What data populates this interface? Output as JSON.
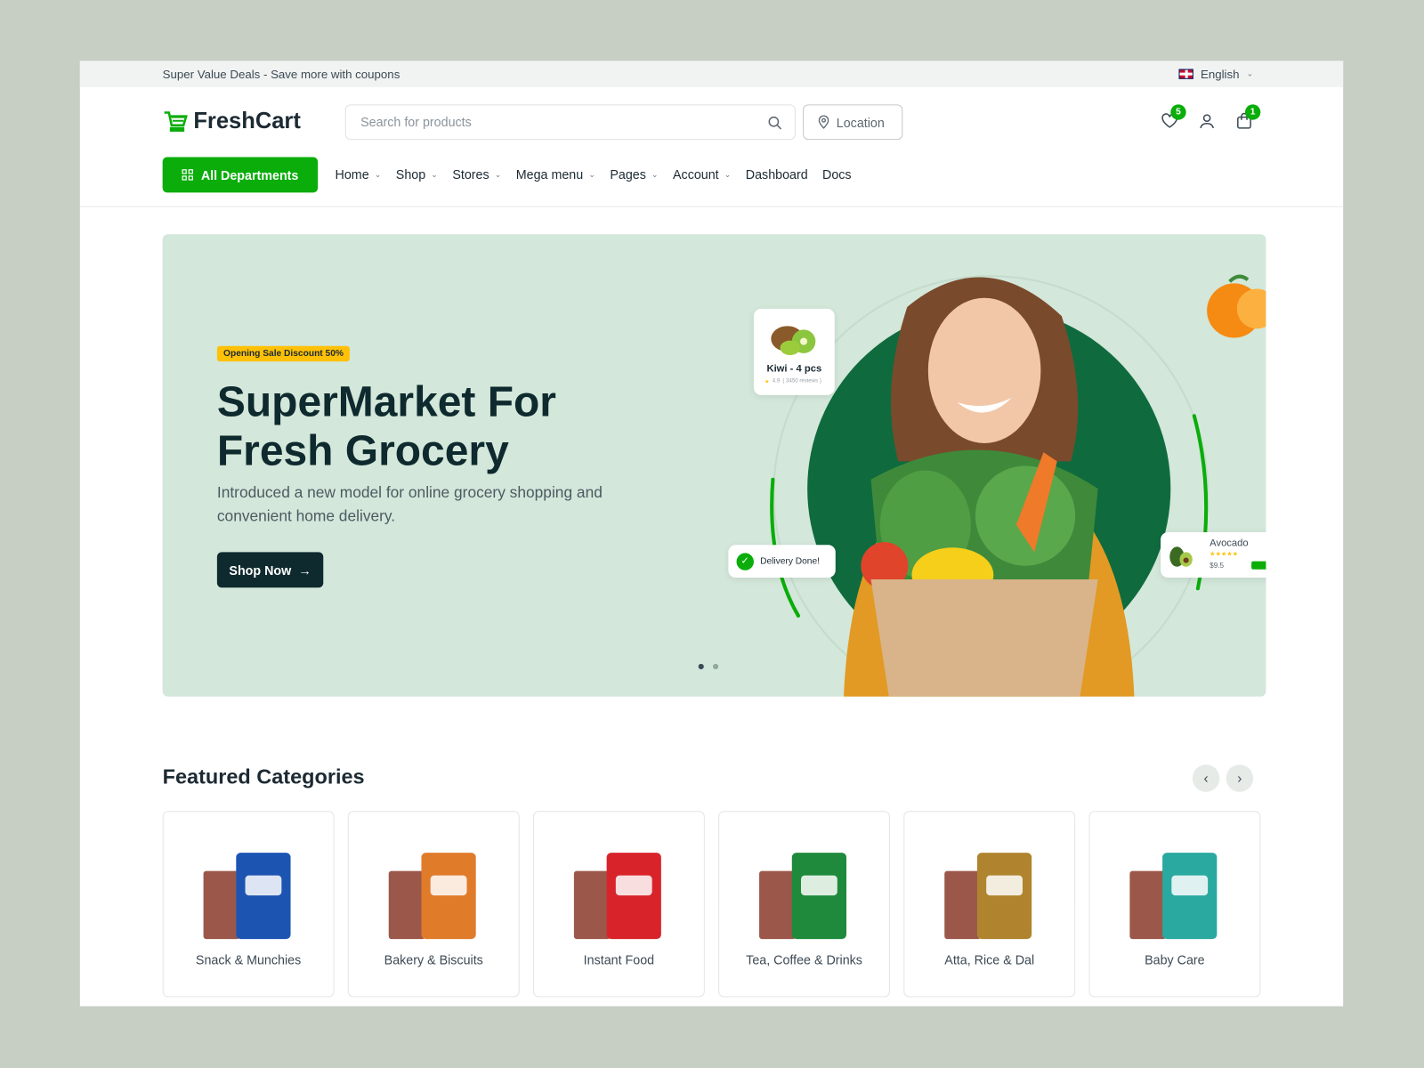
{
  "topbar": {
    "deal": "Super Value Deals - Save more with coupons",
    "language": "English"
  },
  "header": {
    "logo": "FreshCart",
    "search_placeholder": "Search for products",
    "location_label": "Location",
    "wishlist_count": "5",
    "cart_count": "1"
  },
  "nav": {
    "departments": "All Departments",
    "items": [
      {
        "label": "Home",
        "dropdown": true
      },
      {
        "label": "Shop",
        "dropdown": true
      },
      {
        "label": "Stores",
        "dropdown": true
      },
      {
        "label": "Mega menu",
        "dropdown": true
      },
      {
        "label": "Pages",
        "dropdown": true
      },
      {
        "label": "Account",
        "dropdown": true
      },
      {
        "label": "Dashboard",
        "dropdown": false
      },
      {
        "label": "Docs",
        "dropdown": false
      }
    ]
  },
  "hero": {
    "tag": "Opening Sale Discount 50%",
    "title": "SuperMarket For Fresh Grocery",
    "subtitle": "Introduced a new model for online grocery shopping and convenient home delivery.",
    "cta": "Shop Now",
    "kiwi": {
      "name": "Kiwi - 4 pcs",
      "rating": "4.9",
      "reviews": "( 3450 reviews )"
    },
    "delivery": "Delivery Done!",
    "avocado": {
      "name": "Avocado",
      "price": "$9.5"
    },
    "slides": 2,
    "active_slide": 1
  },
  "featured": {
    "title": "Featured Categories",
    "categories": [
      {
        "label": "Snack & Munchies",
        "color": "#1c54b2"
      },
      {
        "label": "Bakery & Biscuits",
        "color": "#e07b2a"
      },
      {
        "label": "Instant Food",
        "color": "#d8232a"
      },
      {
        "label": "Tea, Coffee & Drinks",
        "color": "#1f8a3b"
      },
      {
        "label": "Atta, Rice & Dal",
        "color": "#b0842f"
      },
      {
        "label": "Baby Care",
        "color": "#2aa9a0"
      }
    ]
  },
  "colors": {
    "accent": "#0aad0a",
    "dark": "#0f2a2e",
    "hero_bg": "#d3e7da",
    "circle": "#0f6b3e"
  }
}
